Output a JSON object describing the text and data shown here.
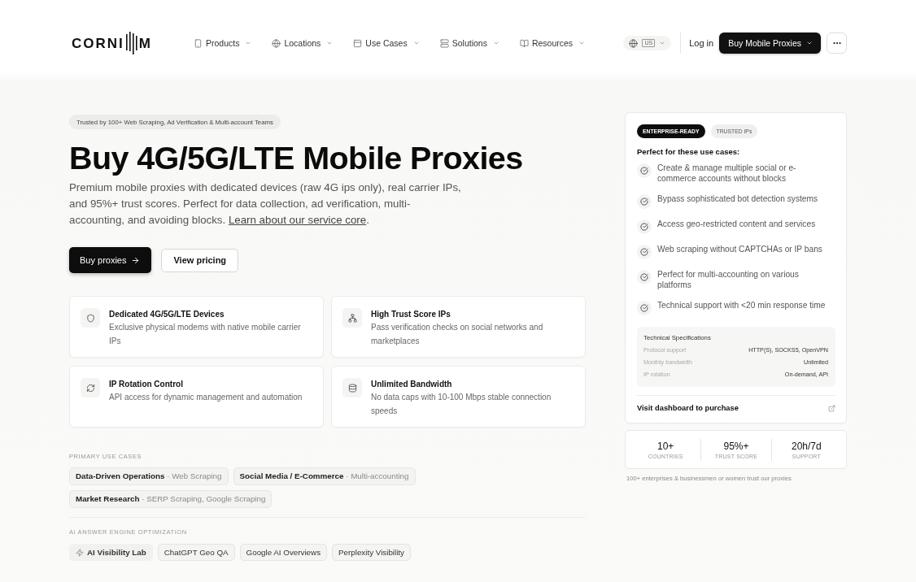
{
  "header": {
    "logo": {
      "lead": "CORNI",
      "tail": "M"
    },
    "nav": [
      {
        "label": "Products"
      },
      {
        "label": "Locations"
      },
      {
        "label": "Use Cases"
      },
      {
        "label": "Solutions"
      },
      {
        "label": "Resources"
      }
    ],
    "region": {
      "code": "US"
    },
    "login": "Log in",
    "cta": "Buy Mobile Proxies"
  },
  "hero": {
    "badge": "Trusted by 100+ Web Scraping, Ad Verification & Multi-account Teams",
    "title": "Buy 4G/5G/LTE Mobile Proxies",
    "description": {
      "text": "Premium mobile proxies with dedicated devices (raw 4G ips only), real carrier IPs, and 95%+ trust scores. Perfect for data collection, ad verification, multi-accounting, and avoiding blocks.",
      "link": "Learn about our service core",
      "tail": "."
    },
    "buttons": [
      {
        "label": "Buy proxies",
        "kind": "primary"
      },
      {
        "label": "View pricing",
        "kind": "secondary"
      }
    ]
  },
  "features": [
    {
      "title": "Dedicated 4G/5G/LTE Devices",
      "description": "Exclusive physical modems with native mobile carrier IPs"
    },
    {
      "title": "High Trust Score IPs",
      "description": "Pass verification checks on social networks and marketplaces"
    },
    {
      "title": "IP Rotation Control",
      "description": "API access for dynamic management and automation"
    },
    {
      "title": "Unlimited Bandwidth",
      "description": "No data caps with 10-100 Mbps stable connection speeds"
    }
  ],
  "use_cases": {
    "heading": "PRIMARY USE CASES",
    "chips": [
      "**Data-Driven Operations** · Web Scraping",
      "**Social Media / E-Commerce** · Multi-accounting",
      "**Market Research** · SERP Scraping, Google Scraping"
    ]
  },
  "aeo": {
    "heading": "AI ANSWER ENGINE OPTIMIZATION",
    "chips": [
      {
        "label": "AI Visibility Lab",
        "kind": "lab"
      },
      {
        "label": "ChatGPT Geo QA",
        "kind": "topic"
      },
      {
        "label": "Google AI Overviews",
        "kind": "topic"
      },
      {
        "label": "Perplexity Visibility",
        "kind": "topic"
      }
    ]
  },
  "panel": {
    "tags": [
      {
        "label": "ENTERPRISE-READY",
        "kind": "primary"
      },
      {
        "label": "TRUSTED IPs",
        "kind": "secondary"
      }
    ],
    "heading": "Perfect for these use cases:",
    "items": [
      "Create & manage multiple social or e-commerce accounts without blocks",
      "Bypass sophisticated bot detection systems",
      "Access geo-restricted content and services",
      "Web scraping without CAPTCHAs or IP bans",
      "Perfect for multi-accounting on various platforms",
      "Technical support with <20 min response time"
    ],
    "specs": {
      "title": "Technical Specifications",
      "rows": [
        {
          "label": "Protocol support",
          "value": "HTTP(S), SOCKS5, OpenVPN"
        },
        {
          "label": "Monthly bandwidth",
          "value": "Unlimited"
        },
        {
          "label": "IP rotation",
          "value": "On-demand, API"
        }
      ]
    },
    "link": "Visit dashboard to purchase"
  },
  "stats": [
    {
      "value": "10+",
      "label": "COUNTRIES"
    },
    {
      "value": "95%+",
      "label": "TRUST SCORE"
    },
    {
      "value": "20h/7d",
      "label": "SUPPORT"
    }
  ],
  "trust_note": "100+ enterprises & businessmen or women trust our proxies"
}
